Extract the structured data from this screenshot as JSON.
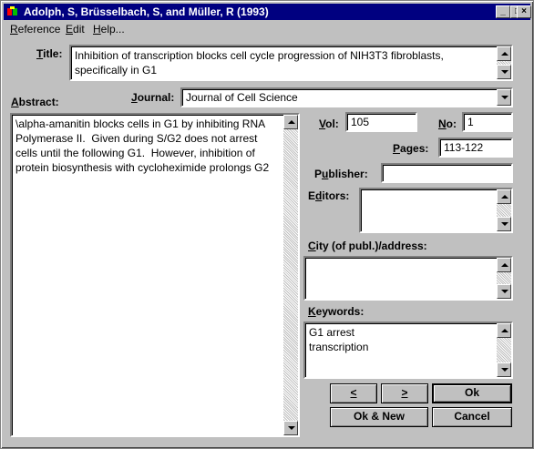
{
  "window": {
    "title": "Adolph, S, Brüsselbach, S, and Müller, R (1993)",
    "minimize": "_",
    "maximize": "□",
    "close": "×"
  },
  "menu": {
    "items": [
      "Reference",
      "Edit",
      "Help..."
    ]
  },
  "form": {
    "title_label": "Title:",
    "title_value": "Inhibition of transcription blocks cell cycle progression of NIH3T3 fibroblasts, specifically in G1",
    "abstract_label": "Abstract:",
    "abstract_value": "\\alpha-amanitin blocks cells in G1 by inhibiting RNA Polymerase II.  Given during S/G2 does not arrest cells until the following G1.  However, inhibition of protein biosynthesis with cycloheximide prolongs G2",
    "journal_label": "Journal:",
    "journal_value": "Journal of Cell Science",
    "vol_label": "Vol:",
    "vol_value": "105",
    "no_label": "No:",
    "no_value": "1",
    "pages_label": "Pages:",
    "pages_value": "113-122",
    "publisher_label": "Publisher:",
    "publisher_value": "",
    "editors_label": "Editors:",
    "editors_value": "",
    "city_label": "City (of publ.)/address:",
    "city_value": "",
    "keywords_label": "Keywords:",
    "keywords_value": "G1 arrest\ntranscription"
  },
  "buttons": {
    "prev": "<",
    "next": ">",
    "ok": "Ok",
    "ok_new": "Ok & New",
    "cancel": "Cancel"
  }
}
